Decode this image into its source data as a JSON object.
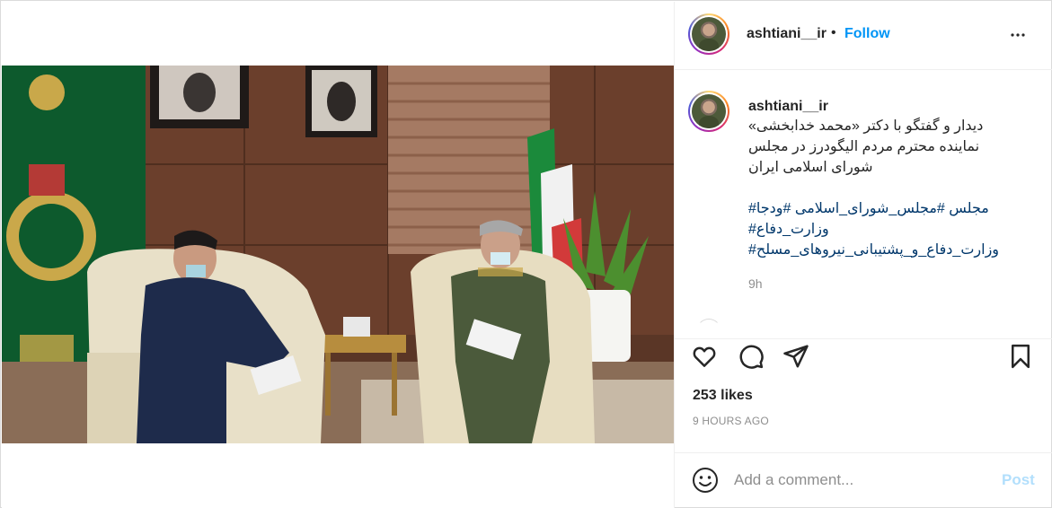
{
  "post": {
    "username": "ashtiani__ir",
    "separator": "•",
    "follow_label": "Follow",
    "caption_lines": [
      "دیدار و گفتگو با دکتر «محمد خدابخشی»",
      "نماینده محترم مردم الیگودرز در مجلس",
      "شورای اسلامی ایران"
    ],
    "hashtag_lines": [
      "مجلس #مجلس_شورای_اسلامی #ودجا#",
      "وزارت_دفاع#",
      "وزارت_دفاع_و_پشتیبانی_نیروهای_مسلح#"
    ],
    "caption_time": "9h",
    "likes": "253 likes",
    "time_ago": "9 HOURS AGO"
  },
  "comment_box": {
    "placeholder": "Add a comment...",
    "post_label": "Post"
  },
  "icons": {
    "more": "more-options-icon",
    "like": "heart-icon",
    "comment": "comment-icon",
    "share": "share-icon",
    "save": "bookmark-icon",
    "emoji": "emoji-icon"
  },
  "colors": {
    "link": "#0095f6",
    "hashtag": "#00376b",
    "muted": "#8e8e8e",
    "post_disabled": "#b2dffc"
  }
}
